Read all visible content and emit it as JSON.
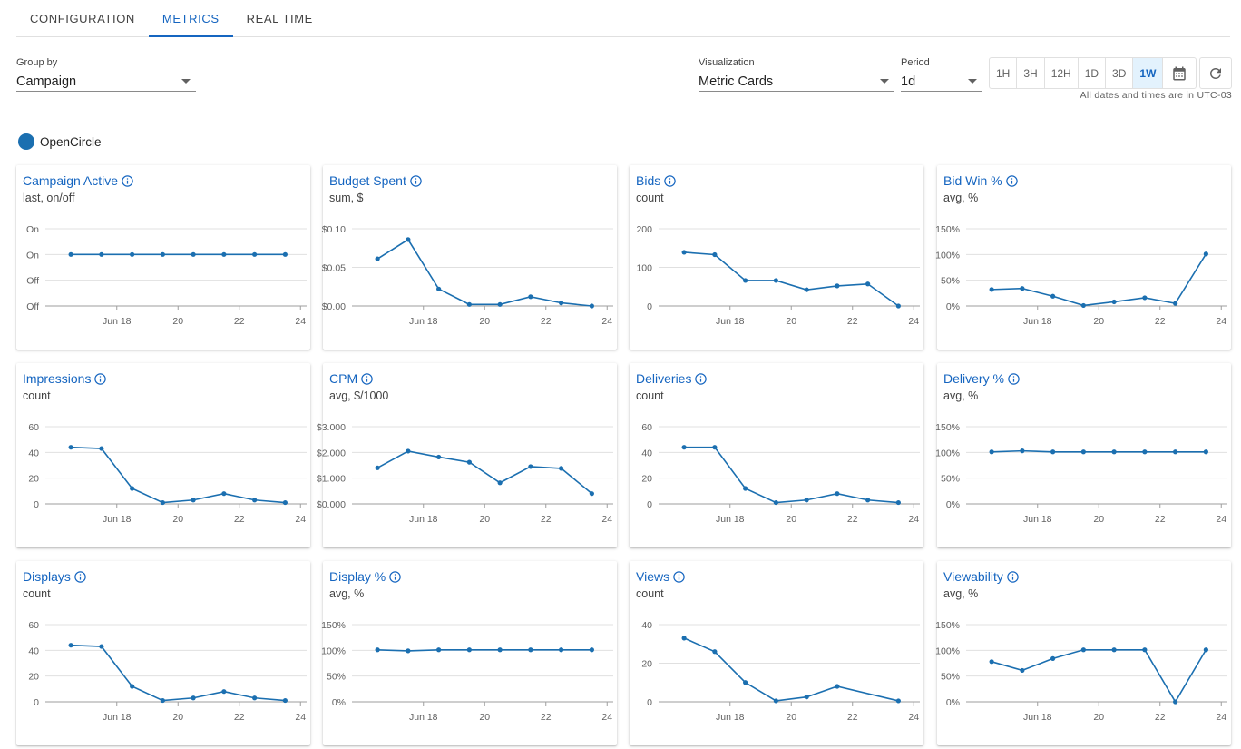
{
  "tabs": [
    {
      "label": "CONFIGURATION",
      "active": false
    },
    {
      "label": "METRICS",
      "active": true
    },
    {
      "label": "REAL TIME",
      "active": false
    }
  ],
  "controls": {
    "group_by": {
      "label": "Group by",
      "value": "Campaign"
    },
    "visualization": {
      "label": "Visualization",
      "value": "Metric Cards"
    },
    "period": {
      "label": "Period",
      "value": "1d"
    },
    "ranges": [
      "1H",
      "3H",
      "12H",
      "1D",
      "3D",
      "1W"
    ],
    "active_range": "1W",
    "timezone_note": "All dates and times are in UTC-03"
  },
  "legend": {
    "name": "OpenCircle",
    "color": "#1b6fb0"
  },
  "colors": {
    "accent": "#1565c0",
    "series": "#1b6fb0",
    "grid": "#e0e0e0"
  },
  "icons": {
    "info": "info-icon",
    "calendar": "calendar-icon",
    "refresh": "refresh-icon",
    "dropdown": "chevron-down-icon"
  },
  "x_axis": {
    "x": [
      16.5,
      17.5,
      18.5,
      19.5,
      20.5,
      21.5,
      22.5,
      23.5
    ],
    "ticks": [
      18,
      20,
      22,
      24
    ],
    "tick_labels": [
      "Jun 18",
      "20",
      "22",
      "24"
    ],
    "range": [
      16.2,
      24.2
    ]
  },
  "chart_data": [
    {
      "type": "line",
      "title": "Campaign Active",
      "subtitle": "last, on/off",
      "y_ticks": [
        0,
        1,
        2,
        3
      ],
      "y_tick_labels": [
        "Off",
        "Off",
        "On",
        "On"
      ],
      "ylim": [
        0,
        3
      ],
      "series": [
        {
          "name": "OpenCircle",
          "values": [
            2,
            2,
            2,
            2,
            2,
            2,
            2,
            2
          ]
        }
      ]
    },
    {
      "type": "line",
      "title": "Budget Spent",
      "subtitle": "sum, $",
      "y_ticks": [
        0,
        0.05,
        0.1
      ],
      "y_tick_labels": [
        "$0.00",
        "$0.05",
        "$0.10"
      ],
      "ylim": [
        0,
        0.1
      ],
      "series": [
        {
          "name": "OpenCircle",
          "values": [
            0.061,
            0.086,
            0.022,
            0.002,
            0.002,
            0.012,
            0.004,
            0
          ]
        }
      ]
    },
    {
      "type": "line",
      "title": "Bids",
      "subtitle": "count",
      "y_ticks": [
        0,
        100,
        200
      ],
      "y_tick_labels": [
        "0",
        "100",
        "200"
      ],
      "ylim": [
        0,
        200
      ],
      "series": [
        {
          "name": "OpenCircle",
          "values": [
            139,
            133,
            66,
            66,
            42,
            52,
            57,
            0
          ]
        }
      ]
    },
    {
      "type": "line",
      "title": "Bid Win %",
      "subtitle": "avg, %",
      "y_ticks": [
        0,
        50,
        100,
        150
      ],
      "y_tick_labels": [
        "0%",
        "50%",
        "100%",
        "150%"
      ],
      "ylim": [
        0,
        150
      ],
      "series": [
        {
          "name": "OpenCircle",
          "values": [
            32,
            34,
            19,
            1,
            8,
            16,
            5,
            101
          ]
        }
      ]
    },
    {
      "type": "line",
      "title": "Impressions",
      "subtitle": "count",
      "y_ticks": [
        0,
        20,
        40,
        60
      ],
      "y_tick_labels": [
        "0",
        "20",
        "40",
        "60"
      ],
      "ylim": [
        0,
        60
      ],
      "series": [
        {
          "name": "OpenCircle",
          "values": [
            44,
            43,
            12,
            1,
            3,
            8,
            3,
            1
          ]
        }
      ]
    },
    {
      "type": "line",
      "title": "CPM",
      "subtitle": "avg, $/1000",
      "y_ticks": [
        0,
        1000,
        2000,
        3000
      ],
      "y_tick_labels": [
        "$0.000",
        "$1.000",
        "$2.000",
        "$3.000"
      ],
      "ylim": [
        0,
        3000
      ],
      "series": [
        {
          "name": "OpenCircle",
          "values": [
            1400,
            2050,
            1820,
            1620,
            820,
            1450,
            1380,
            400
          ]
        }
      ]
    },
    {
      "type": "line",
      "title": "Deliveries",
      "subtitle": "count",
      "y_ticks": [
        0,
        20,
        40,
        60
      ],
      "y_tick_labels": [
        "0",
        "20",
        "40",
        "60"
      ],
      "ylim": [
        0,
        60
      ],
      "series": [
        {
          "name": "OpenCircle",
          "values": [
            44,
            44,
            12,
            1,
            3,
            8,
            3,
            1
          ]
        }
      ]
    },
    {
      "type": "line",
      "title": "Delivery %",
      "subtitle": "avg, %",
      "y_ticks": [
        0,
        50,
        100,
        150
      ],
      "y_tick_labels": [
        "0%",
        "50%",
        "100%",
        "150%"
      ],
      "ylim": [
        0,
        150
      ],
      "series": [
        {
          "name": "OpenCircle",
          "values": [
            101,
            103,
            101,
            101,
            101,
            101,
            101,
            101
          ]
        }
      ]
    },
    {
      "type": "line",
      "title": "Displays",
      "subtitle": "count",
      "y_ticks": [
        0,
        20,
        40,
        60
      ],
      "y_tick_labels": [
        "0",
        "20",
        "40",
        "60"
      ],
      "ylim": [
        0,
        60
      ],
      "series": [
        {
          "name": "OpenCircle",
          "values": [
            44,
            43,
            12,
            1,
            3,
            8,
            3,
            1
          ]
        }
      ]
    },
    {
      "type": "line",
      "title": "Display %",
      "subtitle": "avg, %",
      "y_ticks": [
        0,
        50,
        100,
        150
      ],
      "y_tick_labels": [
        "0%",
        "50%",
        "100%",
        "150%"
      ],
      "ylim": [
        0,
        150
      ],
      "series": [
        {
          "name": "OpenCircle",
          "values": [
            101,
            99,
            101,
            101,
            101,
            101,
            101,
            101
          ]
        }
      ]
    },
    {
      "type": "line",
      "title": "Views",
      "subtitle": "count",
      "y_ticks": [
        0,
        20,
        40
      ],
      "y_tick_labels": [
        "0",
        "20",
        "40"
      ],
      "ylim": [
        0,
        40
      ],
      "series": [
        {
          "name": "OpenCircle",
          "values": [
            33,
            26,
            10,
            0.5,
            2.5,
            8,
            0.5
          ]
        }
      ]
    },
    {
      "type": "line",
      "title": "Viewability",
      "subtitle": "avg, %",
      "y_ticks": [
        0,
        50,
        100,
        150
      ],
      "y_tick_labels": [
        "0%",
        "50%",
        "100%",
        "150%"
      ],
      "ylim": [
        0,
        150
      ],
      "series": [
        {
          "name": "OpenCircle",
          "values": [
            78,
            61,
            84,
            101,
            101,
            101,
            0,
            101
          ]
        }
      ]
    }
  ]
}
